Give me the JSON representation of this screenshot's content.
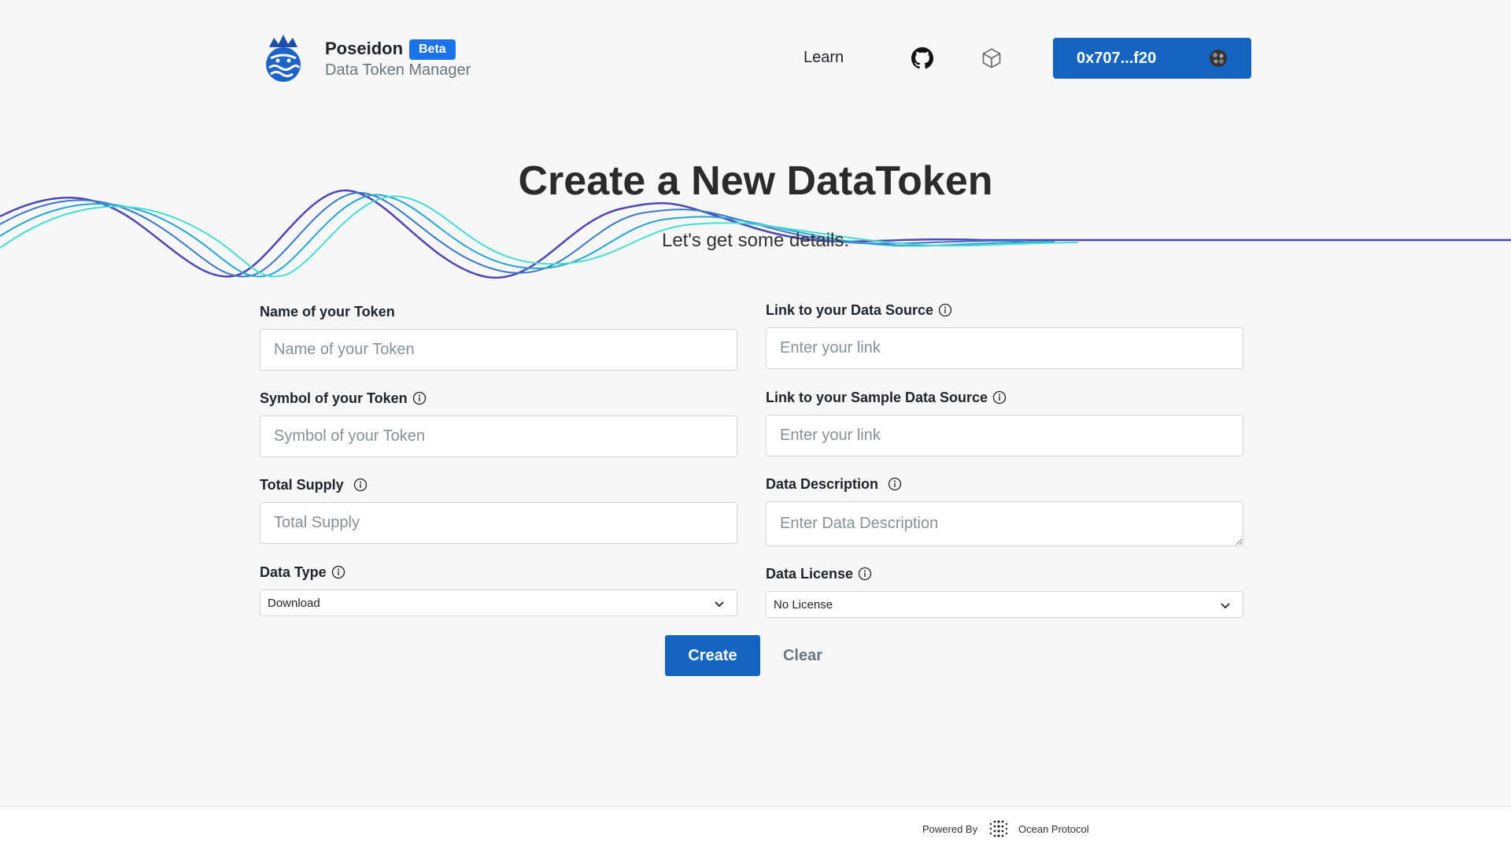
{
  "header": {
    "brand_name": "Poseidon",
    "badge": "Beta",
    "brand_subtitle": "Data Token Manager",
    "nav_learn": "Learn",
    "wallet_address": "0x707...f20",
    "accent_color": "#1565c0"
  },
  "hero": {
    "title": "Create a New DataToken",
    "subtitle": "Let's get some details."
  },
  "form": {
    "token_name": {
      "label": "Name of your Token",
      "placeholder": "Name of your Token",
      "value": ""
    },
    "token_symbol": {
      "label": "Symbol of your Token",
      "placeholder": "Symbol of your Token",
      "value": ""
    },
    "total_supply": {
      "label": "Total Supply",
      "placeholder": "Total Supply",
      "value": ""
    },
    "data_type": {
      "label": "Data Type",
      "selected": "Download"
    },
    "data_source": {
      "label": "Link to your Data Source",
      "placeholder": "Enter your link",
      "value": ""
    },
    "sample_source": {
      "label": "Link to your Sample Data Source",
      "placeholder": "Enter your link",
      "value": ""
    },
    "description": {
      "label": "Data Description",
      "placeholder": "Enter Data Description",
      "value": ""
    },
    "license": {
      "label": "Data License",
      "selected": "No License"
    }
  },
  "actions": {
    "create": "Create",
    "clear": "Clear"
  },
  "footer": {
    "powered_by": "Powered By",
    "provider": "Ocean Protocol"
  },
  "icons": [
    "poseidon-logo",
    "github-icon",
    "cube-icon",
    "wallet-avatar-icon",
    "info-icon",
    "chevron-down-icon",
    "ocean-protocol-logo"
  ]
}
